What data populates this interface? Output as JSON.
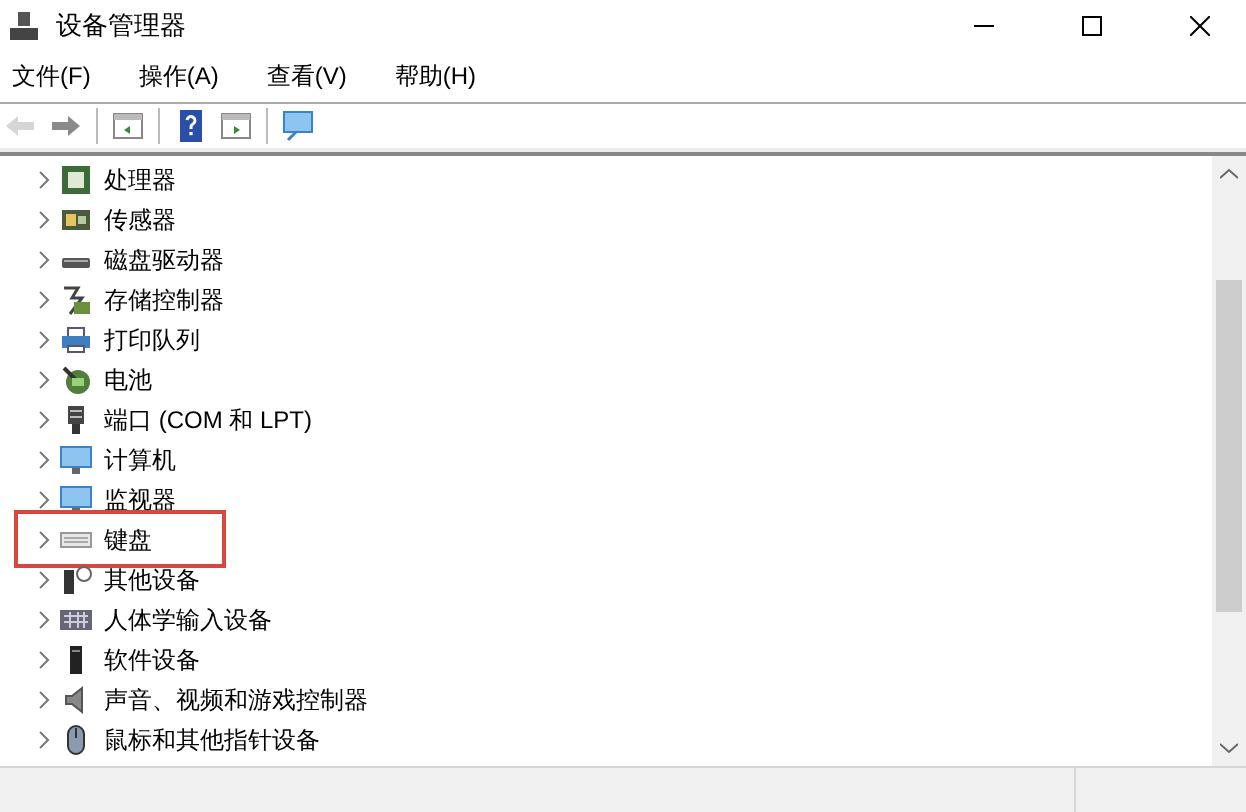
{
  "window": {
    "title": "设备管理器"
  },
  "menu": [
    "文件(F)",
    "操作(A)",
    "查看(V)",
    "帮助(H)"
  ],
  "toolbar": [
    {
      "kind": "back",
      "disabled": true
    },
    {
      "kind": "forward",
      "disabled": false
    },
    {
      "kind": "pane",
      "disabled": false
    },
    {
      "kind": "help",
      "disabled": false
    },
    {
      "kind": "pane2",
      "disabled": false
    },
    {
      "kind": "scan",
      "disabled": false
    }
  ],
  "tree": [
    {
      "label": "处理器",
      "kind": "chip",
      "expanded": false,
      "highlighted": false
    },
    {
      "label": "传感器",
      "kind": "sensor",
      "expanded": false,
      "highlighted": false
    },
    {
      "label": "磁盘驱动器",
      "kind": "drive",
      "expanded": false,
      "highlighted": false
    },
    {
      "label": "存储控制器",
      "kind": "storage",
      "expanded": false,
      "highlighted": false
    },
    {
      "label": "打印队列",
      "kind": "printer",
      "expanded": false,
      "highlighted": false
    },
    {
      "label": "电池",
      "kind": "battery",
      "expanded": false,
      "highlighted": false
    },
    {
      "label": "端口 (COM 和 LPT)",
      "kind": "port",
      "expanded": false,
      "highlighted": false
    },
    {
      "label": "计算机",
      "kind": "monitor",
      "expanded": false,
      "highlighted": false
    },
    {
      "label": "监视器",
      "kind": "monitor",
      "expanded": false,
      "highlighted": false
    },
    {
      "label": "键盘",
      "kind": "keyboard",
      "expanded": false,
      "highlighted": true
    },
    {
      "label": "其他设备",
      "kind": "unknown",
      "expanded": false,
      "highlighted": false
    },
    {
      "label": "人体学输入设备",
      "kind": "hid",
      "expanded": false,
      "highlighted": false
    },
    {
      "label": "软件设备",
      "kind": "software",
      "expanded": false,
      "highlighted": false
    },
    {
      "label": "声音、视频和游戏控制器",
      "kind": "speaker",
      "expanded": false,
      "highlighted": false
    },
    {
      "label": "鼠标和其他指针设备",
      "kind": "mouse",
      "expanded": false,
      "highlighted": false
    }
  ]
}
